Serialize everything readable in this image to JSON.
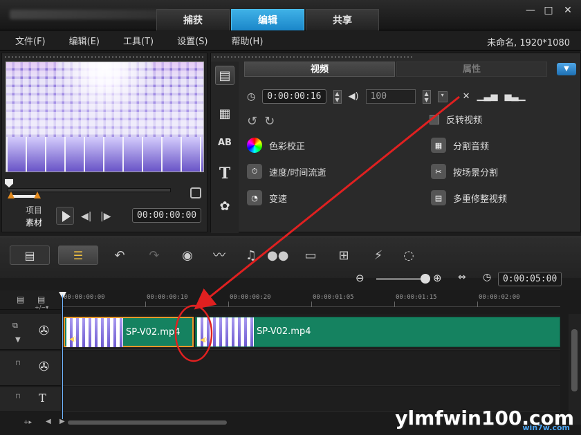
{
  "title_bar": {
    "tabs": [
      {
        "label": "捕获",
        "active": false
      },
      {
        "label": "编辑",
        "active": true
      },
      {
        "label": "共享",
        "active": false
      }
    ],
    "window_controls": {
      "minimize": "—",
      "maximize": "□",
      "close": "✕"
    }
  },
  "menu": {
    "items": [
      "文件(F)",
      "编辑(E)",
      "工具(T)",
      "设置(S)",
      "帮助(H)"
    ],
    "project_info": "未命名, 1920*1080"
  },
  "preview": {
    "mode_project": "项目",
    "mode_clip": "素材",
    "timecode": "00:00:00:00"
  },
  "options": {
    "tabs": [
      "视频",
      "属性"
    ],
    "duration_timecode": "0:00:00:16",
    "volume_value": "100",
    "items_left": [
      "色彩校正",
      "速度/时间流逝",
      "变速"
    ],
    "items_right": [
      "反转视频",
      "分割音频",
      "按场景分割",
      "多重修整视频"
    ]
  },
  "timeline_toolbar": {
    "project_duration": "0:00:05:00"
  },
  "timeline": {
    "ruler_ticks": [
      "00:00:00:00",
      "00:00:00:10",
      "00:00:00:20",
      "00:00:01:05",
      "00:00:01:15",
      "00:00:02:00"
    ],
    "clips": [
      {
        "name": "SP-V02.mp4",
        "selected": true
      },
      {
        "name": "SP-V02.mp4",
        "selected": false
      }
    ],
    "track_header_label": "+/−▾"
  },
  "watermark": {
    "text": "ylmfwin100.com",
    "sub": "win7w.com"
  },
  "colors": {
    "accent_tab": "#1a86c9",
    "clip_green": "#158260",
    "annotation_red": "#e02020"
  }
}
